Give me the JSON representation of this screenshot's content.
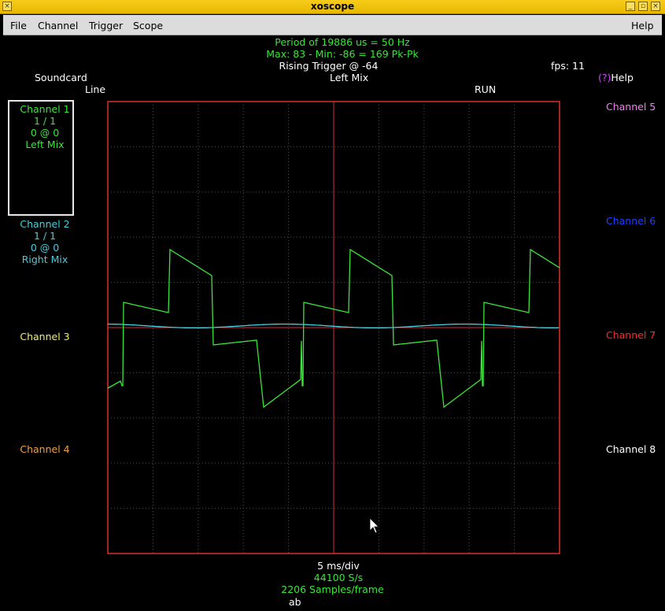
{
  "window": {
    "title": "xoscope"
  },
  "menu": {
    "file": "File",
    "channel": "Channel",
    "trigger": "Trigger",
    "scope": "Scope",
    "help": "Help"
  },
  "header": {
    "period": "Period of  19886 us =     50 Hz",
    "maxmin": "Max: 83 - Min: -86 = 169 Pk-Pk",
    "trigger": "Rising Trigger @ -64",
    "fps": "fps: 11",
    "source": "Soundcard",
    "line": "Line",
    "leftmix": "Left Mix",
    "run": "RUN",
    "help_key": "(?)",
    "help_label": "Help"
  },
  "channels": {
    "ch1": {
      "name": "Channel 1",
      "scale": "1 / 1",
      "pos": "0 @ 0",
      "src": "Left Mix"
    },
    "ch2": {
      "name": "Channel 2",
      "scale": "1 / 1",
      "pos": "0 @ 0",
      "src": "Right Mix"
    },
    "ch3": {
      "name": "Channel 3"
    },
    "ch4": {
      "name": "Channel 4"
    },
    "ch5": {
      "name": "Channel 5"
    },
    "ch6": {
      "name": "Channel 6"
    },
    "ch7": {
      "name": "Channel 7"
    },
    "ch8": {
      "name": "Channel 8"
    }
  },
  "footer": {
    "timebase": "5 ms/div",
    "rate": "44100 S/s",
    "samples": "2206 Samples/frame",
    "mode": "ab"
  },
  "colors": {
    "ch1": "#39e639",
    "ch2": "#40d0e0",
    "grid": "#d83030",
    "graticule_dots": "#b02020"
  }
}
